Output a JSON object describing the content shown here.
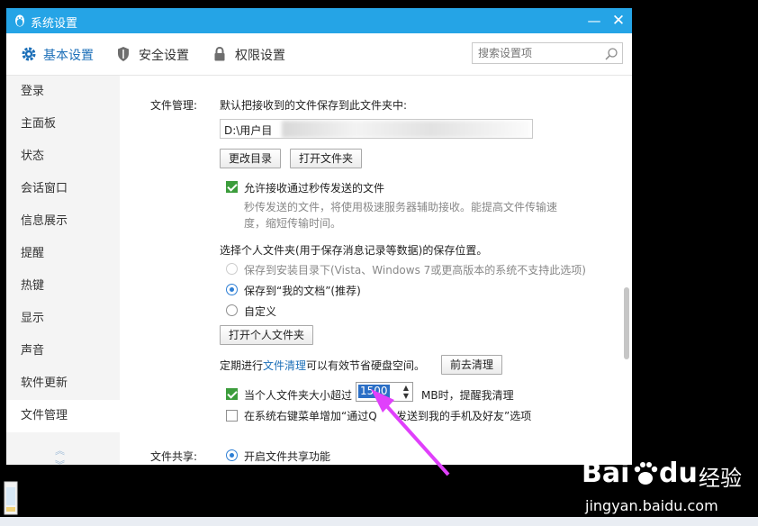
{
  "window": {
    "title": "系统设置",
    "minimize": "—",
    "close": "✕"
  },
  "tabs": [
    {
      "label": "基本设置",
      "icon": "gear-icon",
      "active": true
    },
    {
      "label": "安全设置",
      "icon": "shield-icon",
      "active": false
    },
    {
      "label": "权限设置",
      "icon": "lock-icon",
      "active": false
    }
  ],
  "search": {
    "placeholder": "搜索设置项",
    "icon": "search-icon"
  },
  "sidebar": {
    "items": [
      "登录",
      "主面板",
      "状态",
      "会话窗口",
      "信息展示",
      "提醒",
      "热键",
      "显示",
      "声音",
      "软件更新",
      "文件管理"
    ],
    "active": "文件管理",
    "scroll_up": "︽",
    "scroll_down": "︾"
  },
  "file_management": {
    "section_label": "文件管理:",
    "save_folder_desc": "默认把接收到的文件保存到此文件夹中:",
    "path_value": "D:\\用户目",
    "change_dir_button": "更改目录",
    "open_folder_button": "打开文件夹",
    "instant_transfer_label": "允许接收通过秒传发送的文件",
    "instant_transfer_checked": true,
    "instant_transfer_desc_1": "秒传发送的文件，将使用极速服务器辅助接收。能提高文件传输速",
    "instant_transfer_desc_2": "度，缩短传输时间。",
    "personal_folder_desc": "选择个人文件夹(用于保存消息记录等数据)的保存位置。",
    "radio_options": [
      {
        "label": "保存到安装目录下(Vista、Windows 7或更高版本的系统不支持此选项)",
        "state": "disabled"
      },
      {
        "label": "保存到“我的文档”(推荐)",
        "state": "checked"
      },
      {
        "label": "自定义",
        "state": "unchecked"
      }
    ],
    "open_personal_folder_button": "打开个人文件夹",
    "cleanup_prefix": "定期进行",
    "cleanup_link": "文件清理",
    "cleanup_suffix": "可以有效节省硬盘空间。",
    "go_clean_button": "前去清理",
    "size_limit_prefix": "当个人文件夹大小超过",
    "size_limit_value": "1500",
    "size_limit_suffix": "MB时，提醒我清理",
    "size_limit_checked": true,
    "context_menu_label": "在系统右键菜单增加“通过Q",
    "context_menu_label_2": "发送到我的手机及好友”选项",
    "context_menu_checked": false
  },
  "file_sharing": {
    "section_label": "文件共享:",
    "enable_label": "开启文件共享功能",
    "enable_checked": true
  },
  "annotation": {
    "color": "#e040fb"
  },
  "watermark": {
    "brand": "Bai",
    "brand2": "du",
    "jingyan": "经验",
    "url": "jingyan.baidu.com"
  }
}
